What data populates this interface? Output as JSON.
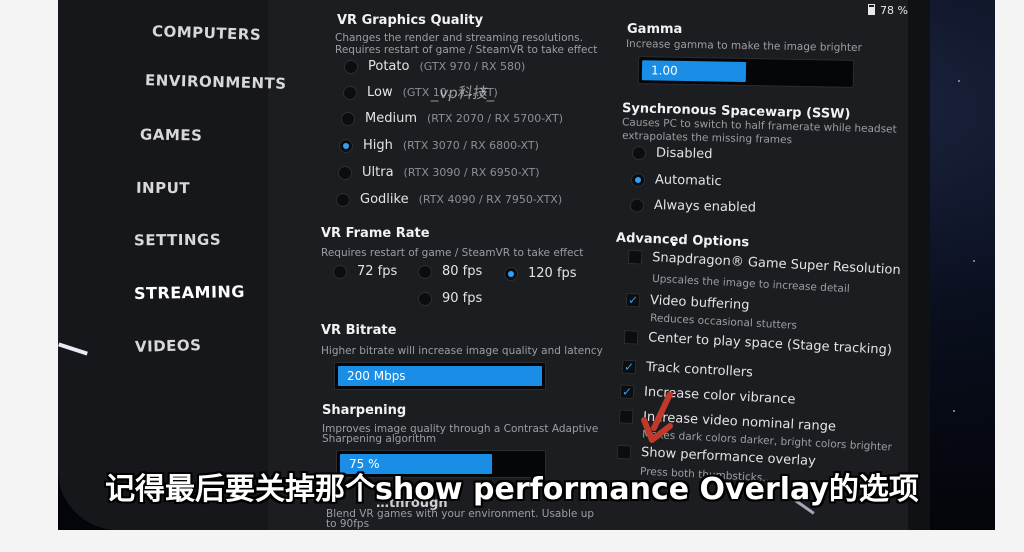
{
  "status": {
    "battery": "78 %"
  },
  "watermark": "_vp科技_",
  "subtitle": "记得最后要关掉那个show performance Overlay的选项",
  "sidebar": {
    "items": [
      {
        "label": "COMPUTERS",
        "active": false
      },
      {
        "label": "ENVIRONMENTS",
        "active": false
      },
      {
        "label": "GAMES",
        "active": false
      },
      {
        "label": "INPUT",
        "active": false
      },
      {
        "label": "SETTINGS",
        "active": false
      },
      {
        "label": "STREAMING",
        "active": true
      },
      {
        "label": "VIDEOS",
        "active": false
      }
    ]
  },
  "graphics_quality": {
    "title": "VR Graphics Quality",
    "desc1": "Changes the render and streaming resolutions.",
    "desc2": "Requires restart of game / SteamVR to take effect",
    "selected": "High",
    "options": [
      {
        "label": "Potato",
        "hint": "(GTX 970 / RX 580)"
      },
      {
        "label": "Low",
        "hint": "(GTX 10… / …XT)"
      },
      {
        "label": "Medium",
        "hint": "(RTX 2070 / RX 5700-XT)"
      },
      {
        "label": "High",
        "hint": "(RTX 3070 / RX 6800-XT)"
      },
      {
        "label": "Ultra",
        "hint": "(RTX 3090 / RX 6950-XT)"
      },
      {
        "label": "Godlike",
        "hint": "(RTX 4090 / RX 7950-XTX)"
      }
    ]
  },
  "frame_rate": {
    "title": "VR Frame Rate",
    "desc": "Requires restart of game / SteamVR to take effect",
    "selected": "120 fps",
    "options": [
      "72 fps",
      "80 fps",
      "120 fps",
      "90 fps"
    ]
  },
  "bitrate": {
    "title": "VR Bitrate",
    "desc": "Higher bitrate will increase image quality and latency",
    "value": "200 Mbps",
    "fill": 1.0
  },
  "sharpening": {
    "title": "Sharpening",
    "desc1": "Improves image quality through a Contrast Adaptive",
    "desc2": "Sharpening algorithm",
    "value": "75 %",
    "fill": 0.75
  },
  "passthrough": {
    "title_fragment": "…through",
    "desc1": "Blend VR games with your environment. Usable up",
    "desc2": "to 90fps"
  },
  "gamma": {
    "title": "Gamma",
    "desc": "Increase gamma to make the image brighter",
    "value": "1.00",
    "fill": 0.5
  },
  "ssw": {
    "title": "Synchronous Spacewarp (SSW)",
    "desc1": "Causes PC to switch to half framerate while headset",
    "desc2": "extrapolates the missing frames",
    "selected": "Automatic",
    "options": [
      "Disabled",
      "Automatic",
      "Always enabled"
    ]
  },
  "advanced": {
    "title": "Advanced Options",
    "items": [
      {
        "label": "Snapdragon® Game Super Resolution",
        "desc": "Upscales the image to increase detail",
        "checked": false
      },
      {
        "label": "Video buffering",
        "desc": "Reduces occasional stutters",
        "checked": true
      },
      {
        "label": "Center to play space (Stage tracking)",
        "desc": "",
        "checked": false
      },
      {
        "label": "Track controllers",
        "desc": "",
        "checked": true
      },
      {
        "label": "Increase color vibrance",
        "desc": "",
        "checked": true
      },
      {
        "label": "Increase video nominal range",
        "desc": "Makes dark colors darker, bright colors brighter",
        "checked": false
      },
      {
        "label": "Show performance overlay",
        "desc": "Press both thumbsticks…",
        "checked": false
      }
    ]
  },
  "colors": {
    "accent": "#1a8ee6",
    "panel": "#1c1d20",
    "text": "#e4e4e4"
  }
}
